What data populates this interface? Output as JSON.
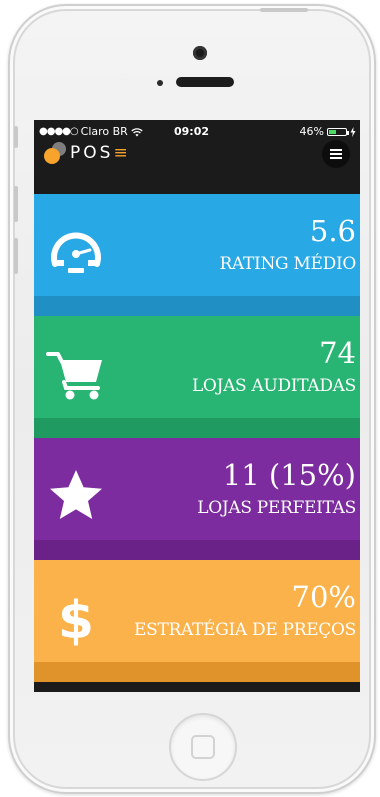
{
  "status": {
    "signal": "●●●●○",
    "carrier": "Claro BR",
    "wifi_icon": "wifi-icon",
    "time": "09:02",
    "battery_pct": "46%",
    "battery_level": 0.46,
    "charging_icon": "bolt-icon"
  },
  "header": {
    "logo_text_main": "POS",
    "logo_text_accent": "≡",
    "logo_colors": {
      "accent": "#f7a32c",
      "gray": "#8a8a8a"
    },
    "menu_icon": "hamburger-menu-icon"
  },
  "cards": [
    {
      "icon": "speedometer-icon",
      "value": "5.6",
      "label": "RATING MÉDIO",
      "color": "#28a8e4"
    },
    {
      "icon": "shopping-cart-icon",
      "value": "74",
      "label": "LOJAS AUDITADAS",
      "color": "#28b573"
    },
    {
      "icon": "star-icon",
      "value": "11 (15%)",
      "label": "LOJAS PERFEITAS",
      "color": "#7c2c9e"
    },
    {
      "icon": "dollar-icon",
      "value": "70%",
      "label": "ESTRATÉGIA DE PREÇOS",
      "color": "#fbb24a"
    }
  ]
}
